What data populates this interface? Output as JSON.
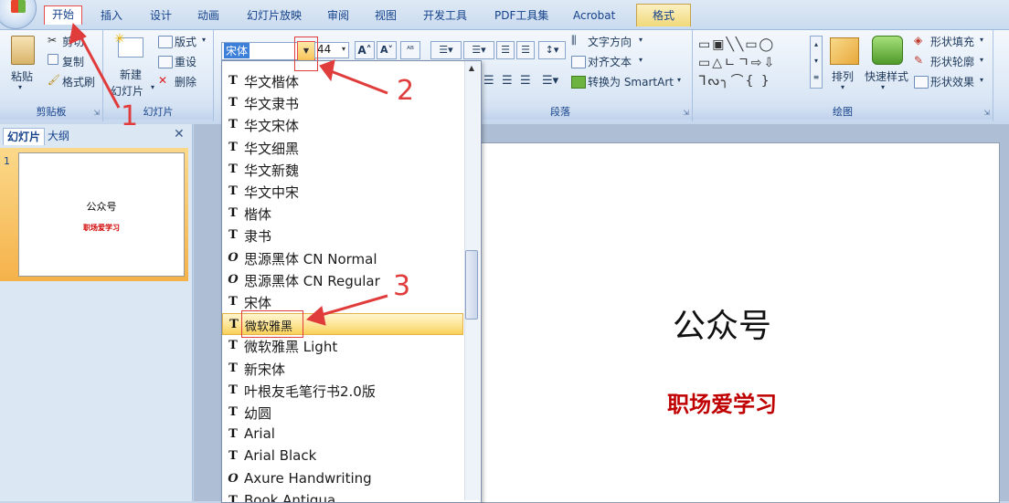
{
  "tabs": [
    "开始",
    "插入",
    "设计",
    "动画",
    "幻灯片放映",
    "审阅",
    "视图",
    "开发工具",
    "PDF工具集",
    "Acrobat",
    "格式"
  ],
  "ribbon": {
    "clipboard": {
      "paste": "粘贴",
      "cut": "剪切",
      "copy": "复制",
      "format_painter": "格式刷",
      "label": "剪贴板"
    },
    "slides": {
      "new_slide": "新建",
      "new_slide2": "幻灯片",
      "layout": "版式",
      "reset": "重设",
      "delete": "删除",
      "label": "幻灯片"
    },
    "font": {
      "name": "宋体",
      "size": "44"
    },
    "paragraph": {
      "text_direction": "文字方向",
      "align_text": "对齐文本",
      "smartart": "转换为 SmartArt",
      "label": "段落"
    },
    "drawing": {
      "arrange": "排列",
      "quick_styles": "快速样式",
      "fill": "形状填充",
      "outline": "形状轮廓",
      "effects": "形状效果",
      "label": "绘图"
    }
  },
  "panel": {
    "tab_slides": "幻灯片",
    "tab_outline": "大纲",
    "slide_number": "1"
  },
  "slide": {
    "title": "公众号",
    "subtitle": "职场爱学习"
  },
  "fonts": [
    {
      "label": "华文楷体",
      "icon": "T",
      "selected": false
    },
    {
      "label": "华文隶书",
      "icon": "T",
      "selected": false
    },
    {
      "label": "华文宋体",
      "icon": "T",
      "selected": false
    },
    {
      "label": "华文细黑",
      "icon": "T",
      "selected": false
    },
    {
      "label": "华文新魏",
      "icon": "T",
      "selected": false
    },
    {
      "label": "华文中宋",
      "icon": "T",
      "selected": false
    },
    {
      "label": "楷体",
      "icon": "T",
      "selected": false
    },
    {
      "label": "隶书",
      "icon": "T",
      "selected": false
    },
    {
      "label": "思源黑体 CN Normal",
      "icon": "O",
      "selected": false
    },
    {
      "label": "思源黑体 CN Regular",
      "icon": "O",
      "selected": false
    },
    {
      "label": "宋体",
      "icon": "T",
      "selected": false
    },
    {
      "label": "微软雅黑",
      "icon": "T",
      "selected": true
    },
    {
      "label": "微软雅黑 Light",
      "icon": "T",
      "selected": false
    },
    {
      "label": "新宋体",
      "icon": "T",
      "selected": false
    },
    {
      "label": "叶根友毛笔行书2.0版",
      "icon": "T",
      "selected": false
    },
    {
      "label": "幼圆",
      "icon": "T",
      "selected": false
    },
    {
      "label": "Arial",
      "icon": "T",
      "selected": false
    },
    {
      "label": "Arial Black",
      "icon": "T",
      "selected": false
    },
    {
      "label": "Axure Handwriting",
      "icon": "O",
      "selected": false
    },
    {
      "label": "Book Antiqua",
      "icon": "T",
      "selected": false
    }
  ],
  "annotations": [
    "1",
    "2",
    "3"
  ],
  "colors": {
    "accent_red": "#e03c3c",
    "subtitle_red": "#c00000"
  }
}
